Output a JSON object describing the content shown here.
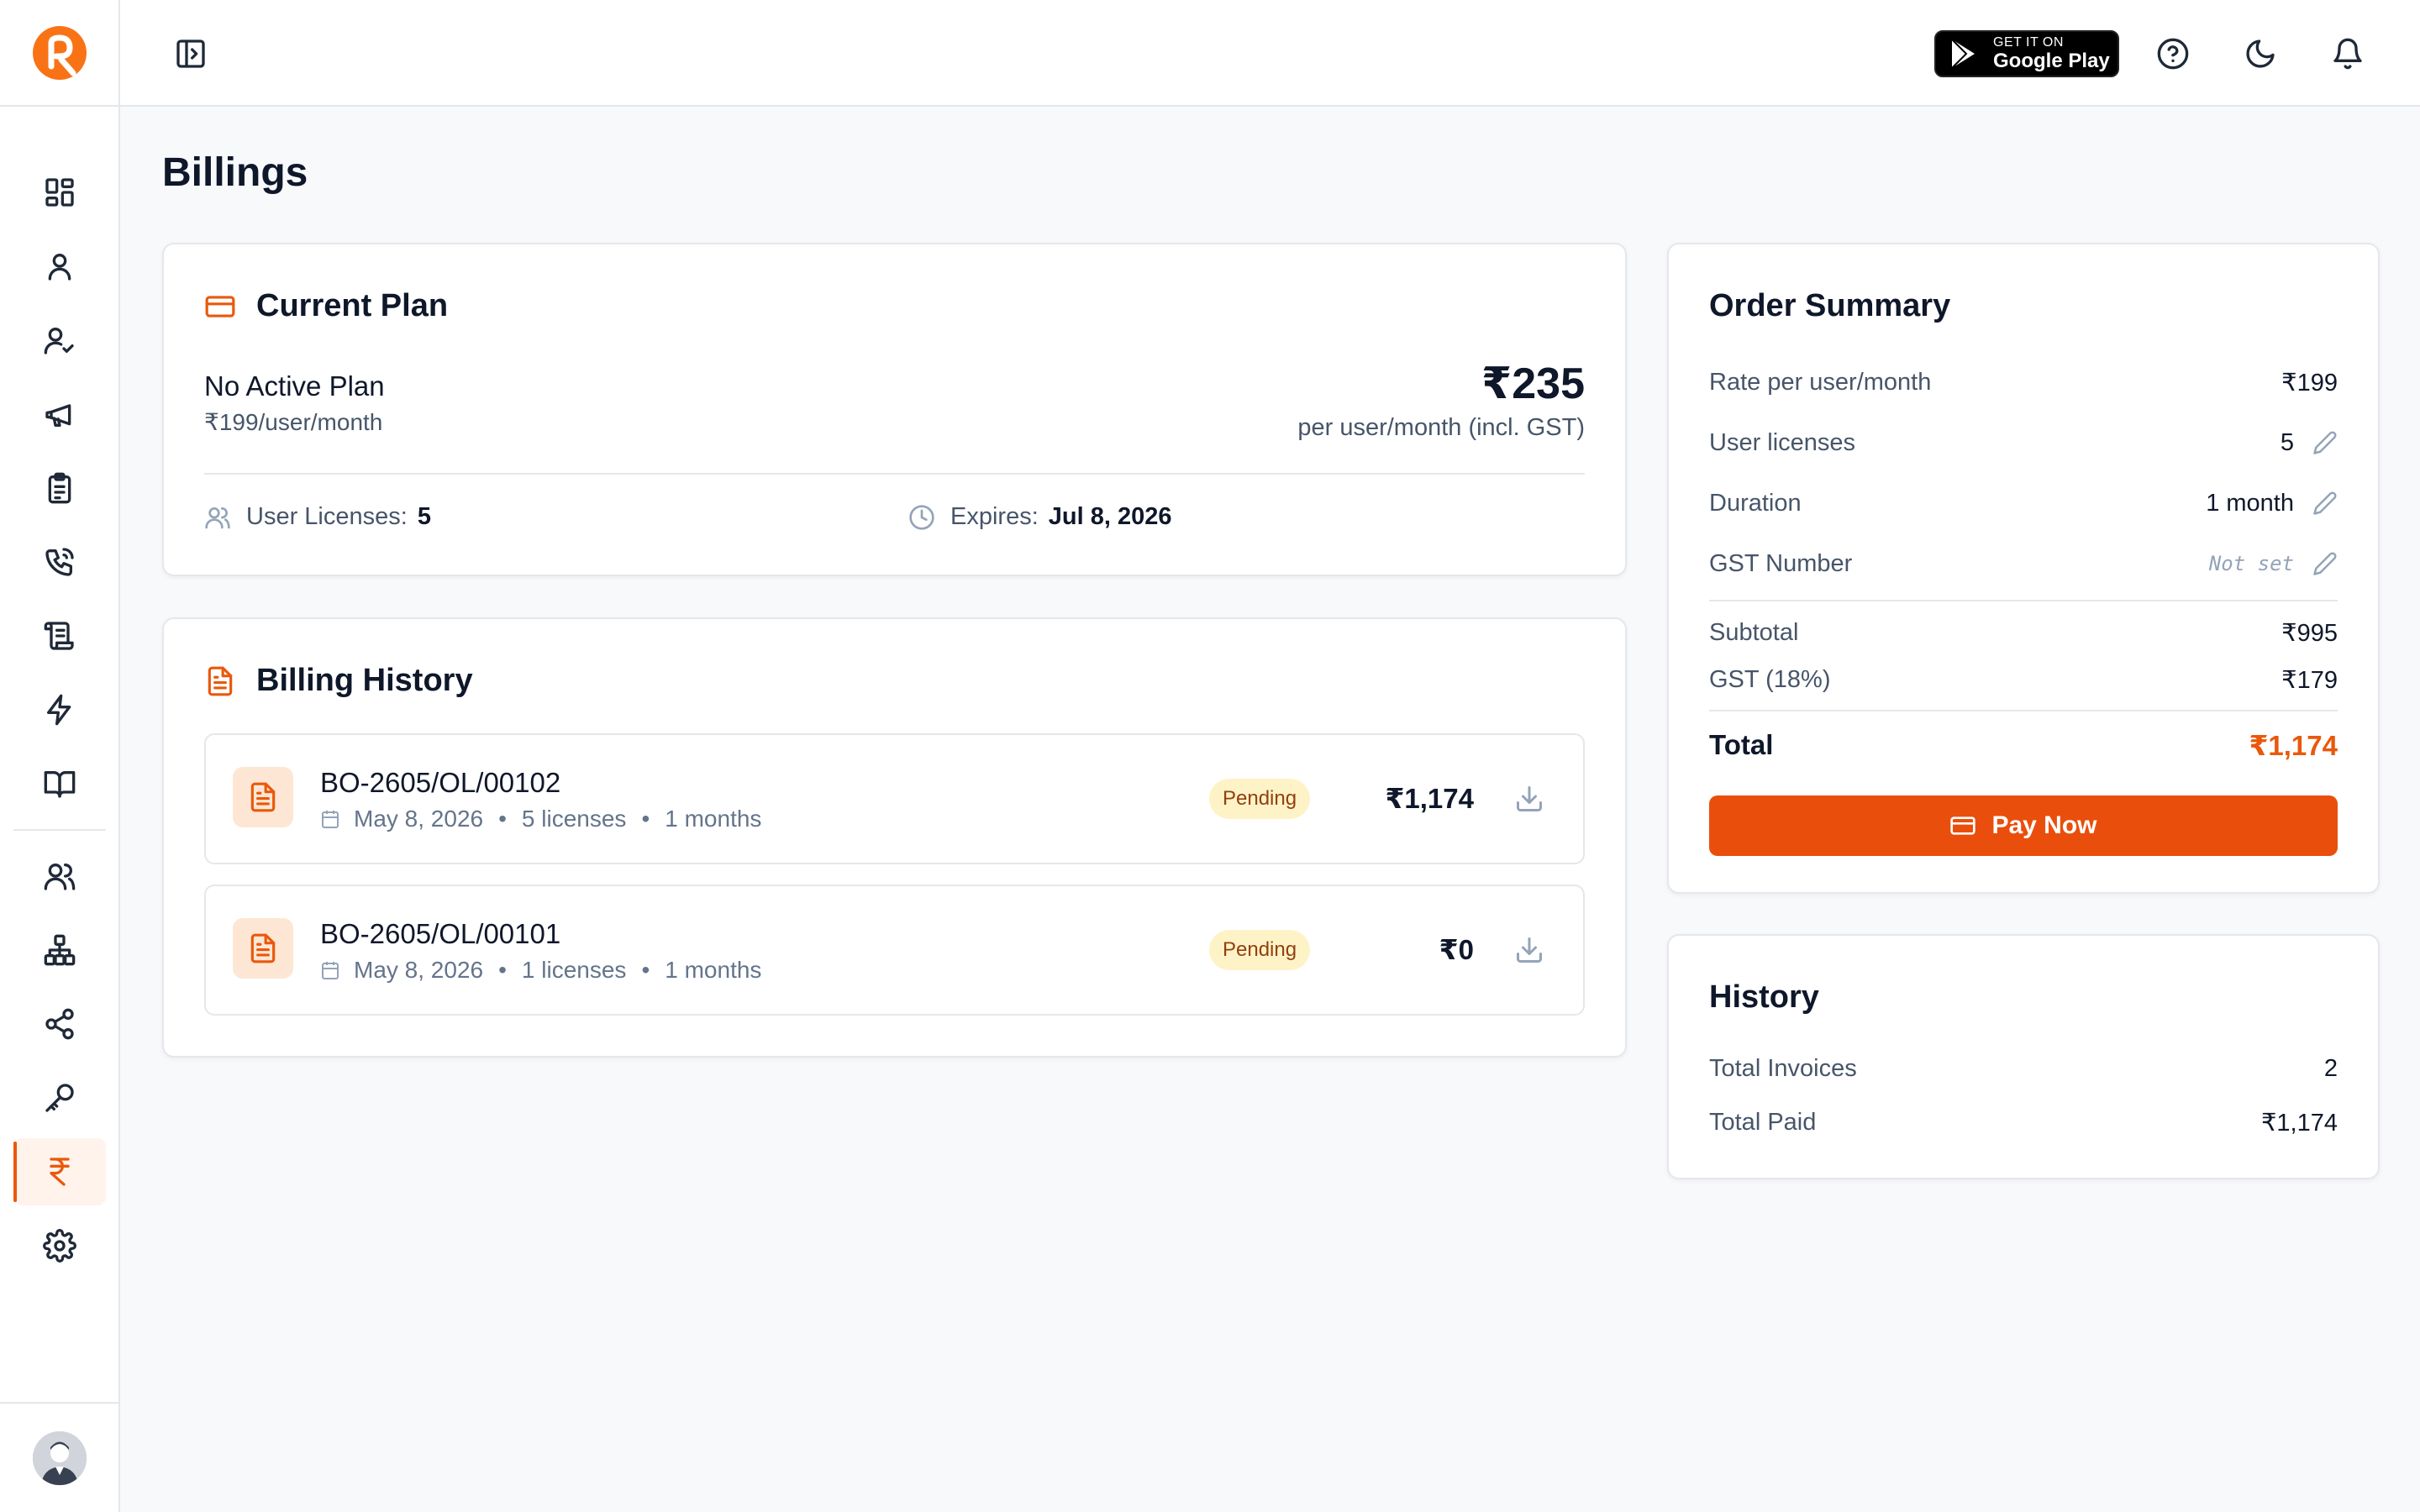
{
  "page": {
    "title": "Billings"
  },
  "topbar": {
    "google_play": {
      "line1": "GET IT ON",
      "line2": "Google Play"
    }
  },
  "current_plan": {
    "title": "Current Plan",
    "plan_name": "No Active Plan",
    "plan_rate": "₹199/user/month",
    "price": "₹235",
    "price_note": "per user/month (incl. GST)",
    "licenses_label": "User Licenses:",
    "licenses_value": "5",
    "expires_label": "Expires:",
    "expires_value": "Jul 8, 2026"
  },
  "billing_history": {
    "title": "Billing History",
    "items": [
      {
        "id": "BO-2605/OL/00102",
        "date": "May 8, 2026",
        "licenses": "5 licenses",
        "duration": "1 months",
        "status": "Pending",
        "amount": "₹1,174"
      },
      {
        "id": "BO-2605/OL/00101",
        "date": "May 8, 2026",
        "licenses": "1 licenses",
        "duration": "1 months",
        "status": "Pending",
        "amount": "₹0"
      }
    ]
  },
  "order_summary": {
    "title": "Order Summary",
    "rate_label": "Rate per user/month",
    "rate_value": "₹199",
    "licenses_label": "User licenses",
    "licenses_value": "5",
    "duration_label": "Duration",
    "duration_value": "1 month",
    "gst_number_label": "GST Number",
    "gst_number_value": "Not set",
    "subtotal_label": "Subtotal",
    "subtotal_value": "₹995",
    "gst_label": "GST (18%)",
    "gst_value": "₹179",
    "total_label": "Total",
    "total_value": "₹1,174",
    "pay_label": "Pay Now"
  },
  "history": {
    "title": "History",
    "invoices_label": "Total Invoices",
    "invoices_value": "2",
    "paid_label": "Total Paid",
    "paid_value": "₹1,174"
  },
  "colors": {
    "accent": "#ea580c",
    "badge_bg": "#fef3c7",
    "badge_text": "#92400e"
  }
}
